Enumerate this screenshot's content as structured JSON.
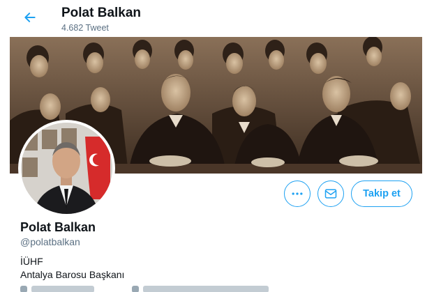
{
  "header": {
    "name": "Polat Balkan",
    "tweet_count": "4.682 Tweet",
    "back_icon": "arrow-left-icon"
  },
  "banner": {
    "description_icon": "historic-photo-banner"
  },
  "profile": {
    "name": "Polat Balkan",
    "handle": "@polatbalkan",
    "bio_line1": "İÜHF",
    "bio_line2": "Antalya Barosu Başkanı"
  },
  "actions": {
    "more_icon": "more-dots-icon",
    "message_icon": "envelope-icon",
    "follow_label": "Takip et"
  },
  "colors": {
    "accent": "#1da1f2",
    "secondary_text": "#5b7083",
    "primary_text": "#0f1419"
  }
}
